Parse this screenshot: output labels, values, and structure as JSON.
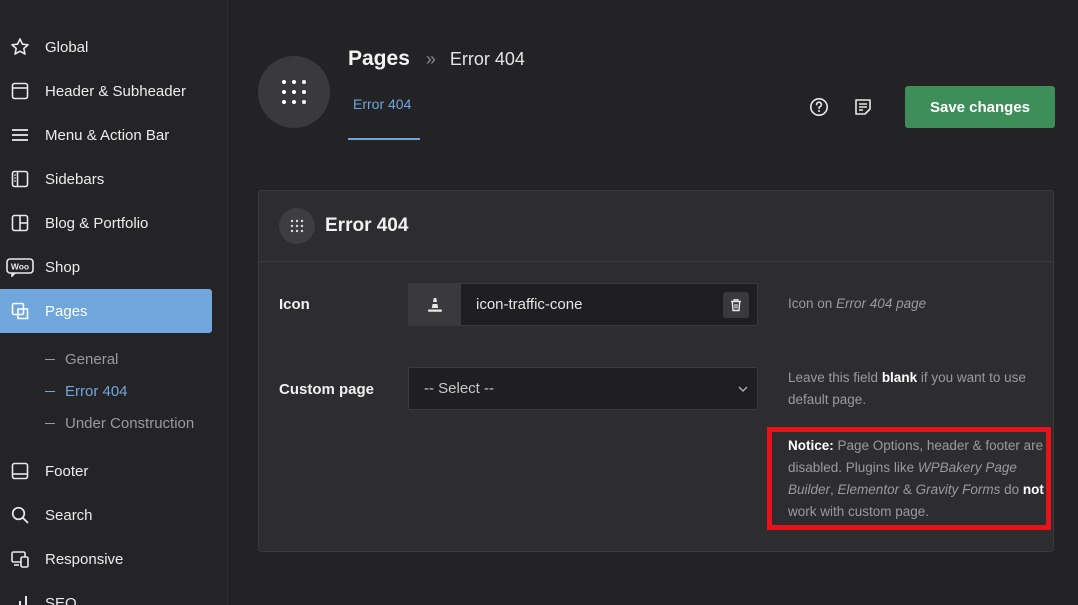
{
  "sidebar": {
    "items": [
      {
        "label": "Global",
        "icon": "star-icon"
      },
      {
        "label": "Header & Subheader",
        "icon": "layout-icon"
      },
      {
        "label": "Menu & Action Bar",
        "icon": "menu-icon"
      },
      {
        "label": "Sidebars",
        "icon": "sidebar-icon"
      },
      {
        "label": "Blog & Portfolio",
        "icon": "grid-icon"
      },
      {
        "label": "Shop",
        "icon": "woo-icon",
        "icon_text": "Woo"
      },
      {
        "label": "Pages",
        "icon": "pages-icon",
        "active": true
      },
      {
        "label": "Footer",
        "icon": "footer-icon"
      },
      {
        "label": "Search",
        "icon": "search-icon"
      },
      {
        "label": "Responsive",
        "icon": "responsive-icon"
      },
      {
        "label": "SEO",
        "icon": "seo-icon"
      }
    ],
    "subitems": [
      {
        "label": "General"
      },
      {
        "label": "Error 404",
        "active": true
      },
      {
        "label": "Under Construction"
      }
    ]
  },
  "header": {
    "breadcrumb_main": "Pages",
    "breadcrumb_sep": "»",
    "breadcrumb_sub": "Error 404",
    "tab_label": "Error 404",
    "save_label": "Save changes"
  },
  "panel": {
    "title": "Error 404",
    "icon_field": {
      "label": "Icon",
      "value": "icon-traffic-cone",
      "help_prefix": "Icon on ",
      "help_em": "Error 404 page"
    },
    "custom_page": {
      "label": "Custom page",
      "selected": "-- Select --",
      "help_1": "Leave this field ",
      "help_bold": "blank",
      "help_2": " if you want to use default page."
    },
    "notice": {
      "lead": "Notice:",
      "text_1": " Page Options, header & footer are disabled. Plugins like ",
      "plugin_1": "WPBakery Page Builder",
      "sep_1": ", ",
      "plugin_2": "Elementor",
      "sep_2": " & ",
      "plugin_3": "Gravity Forms",
      "text_2": " do ",
      "bold": "not",
      "text_3": " work with custom page."
    }
  },
  "colors": {
    "accent": "#6fa6dc",
    "save": "#3e8e5a",
    "notice_border": "#e8131a",
    "background": "#232325"
  }
}
